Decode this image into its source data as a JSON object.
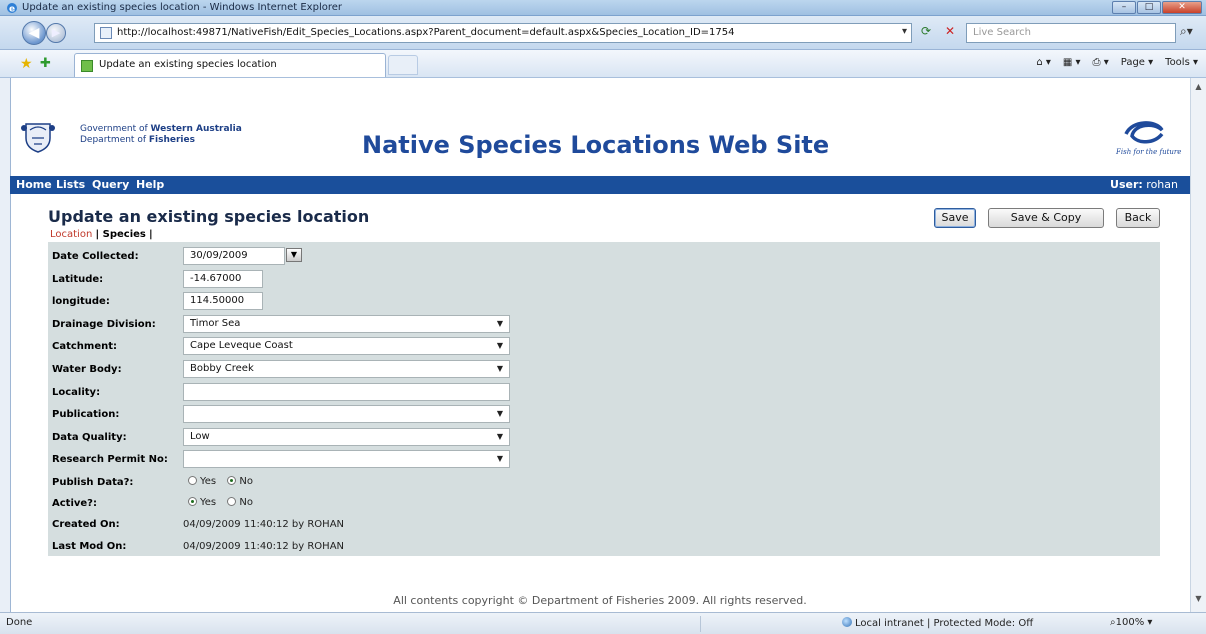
{
  "browser": {
    "window_title": "Update an existing species location - Windows Internet Explorer",
    "url": "http://localhost:49871/NativeFish/Edit_Species_Locations.aspx?Parent_document=default.aspx&Species_Location_ID=1754",
    "search_placeholder": "Live Search",
    "tab_title": "Update an existing species location",
    "commands": {
      "page": "Page ▾",
      "tools": "Tools ▾"
    },
    "status": {
      "left": "Done",
      "zone": "Local intranet | Protected Mode: Off",
      "zoom": "100%"
    }
  },
  "header": {
    "gov_line1_prefix": "Government of ",
    "gov_line1_bold": "Western Australia",
    "gov_line2_prefix": "Department of ",
    "gov_line2_bold": "Fisheries",
    "site_title": "Native Species Locations Web Site",
    "tagline": "Fish for the future"
  },
  "menu": {
    "items": [
      "Home",
      "Lists",
      "Query",
      "Help"
    ],
    "user_label": "User:",
    "user_name": "rohan"
  },
  "page": {
    "heading": "Update an existing species location",
    "tabs": {
      "location": "Location",
      "species": "Species"
    },
    "buttons": {
      "save": "Save",
      "save_copy": "Save & Copy",
      "back": "Back"
    },
    "footer": "All contents copyright © Department of Fisheries 2009. All rights reserved."
  },
  "form": {
    "date_collected": {
      "label": "Date Collected:",
      "value": "30/09/2009"
    },
    "latitude": {
      "label": "Latitude:",
      "value": "-14.67000"
    },
    "longitude": {
      "label": "longitude:",
      "value": "114.50000"
    },
    "drainage_division": {
      "label": "Drainage Division:",
      "value": "Timor Sea"
    },
    "catchment": {
      "label": "Catchment:",
      "value": "Cape Leveque Coast"
    },
    "water_body": {
      "label": "Water Body:",
      "value": "Bobby Creek"
    },
    "locality": {
      "label": "Locality:",
      "value": ""
    },
    "publication": {
      "label": "Publication:",
      "value": ""
    },
    "data_quality": {
      "label": "Data Quality:",
      "value": "Low"
    },
    "research_permit": {
      "label": "Research Permit No:",
      "value": ""
    },
    "publish_data": {
      "label": "Publish Data?:",
      "yes": "Yes",
      "no": "No",
      "selected": "No"
    },
    "active": {
      "label": "Active?:",
      "yes": "Yes",
      "no": "No",
      "selected": "Yes"
    },
    "created_on": {
      "label": "Created On:",
      "value": "04/09/2009 11:40:12 by ROHAN"
    },
    "last_mod_on": {
      "label": "Last Mod On:",
      "value": "04/09/2009 11:40:12 by ROHAN"
    }
  }
}
